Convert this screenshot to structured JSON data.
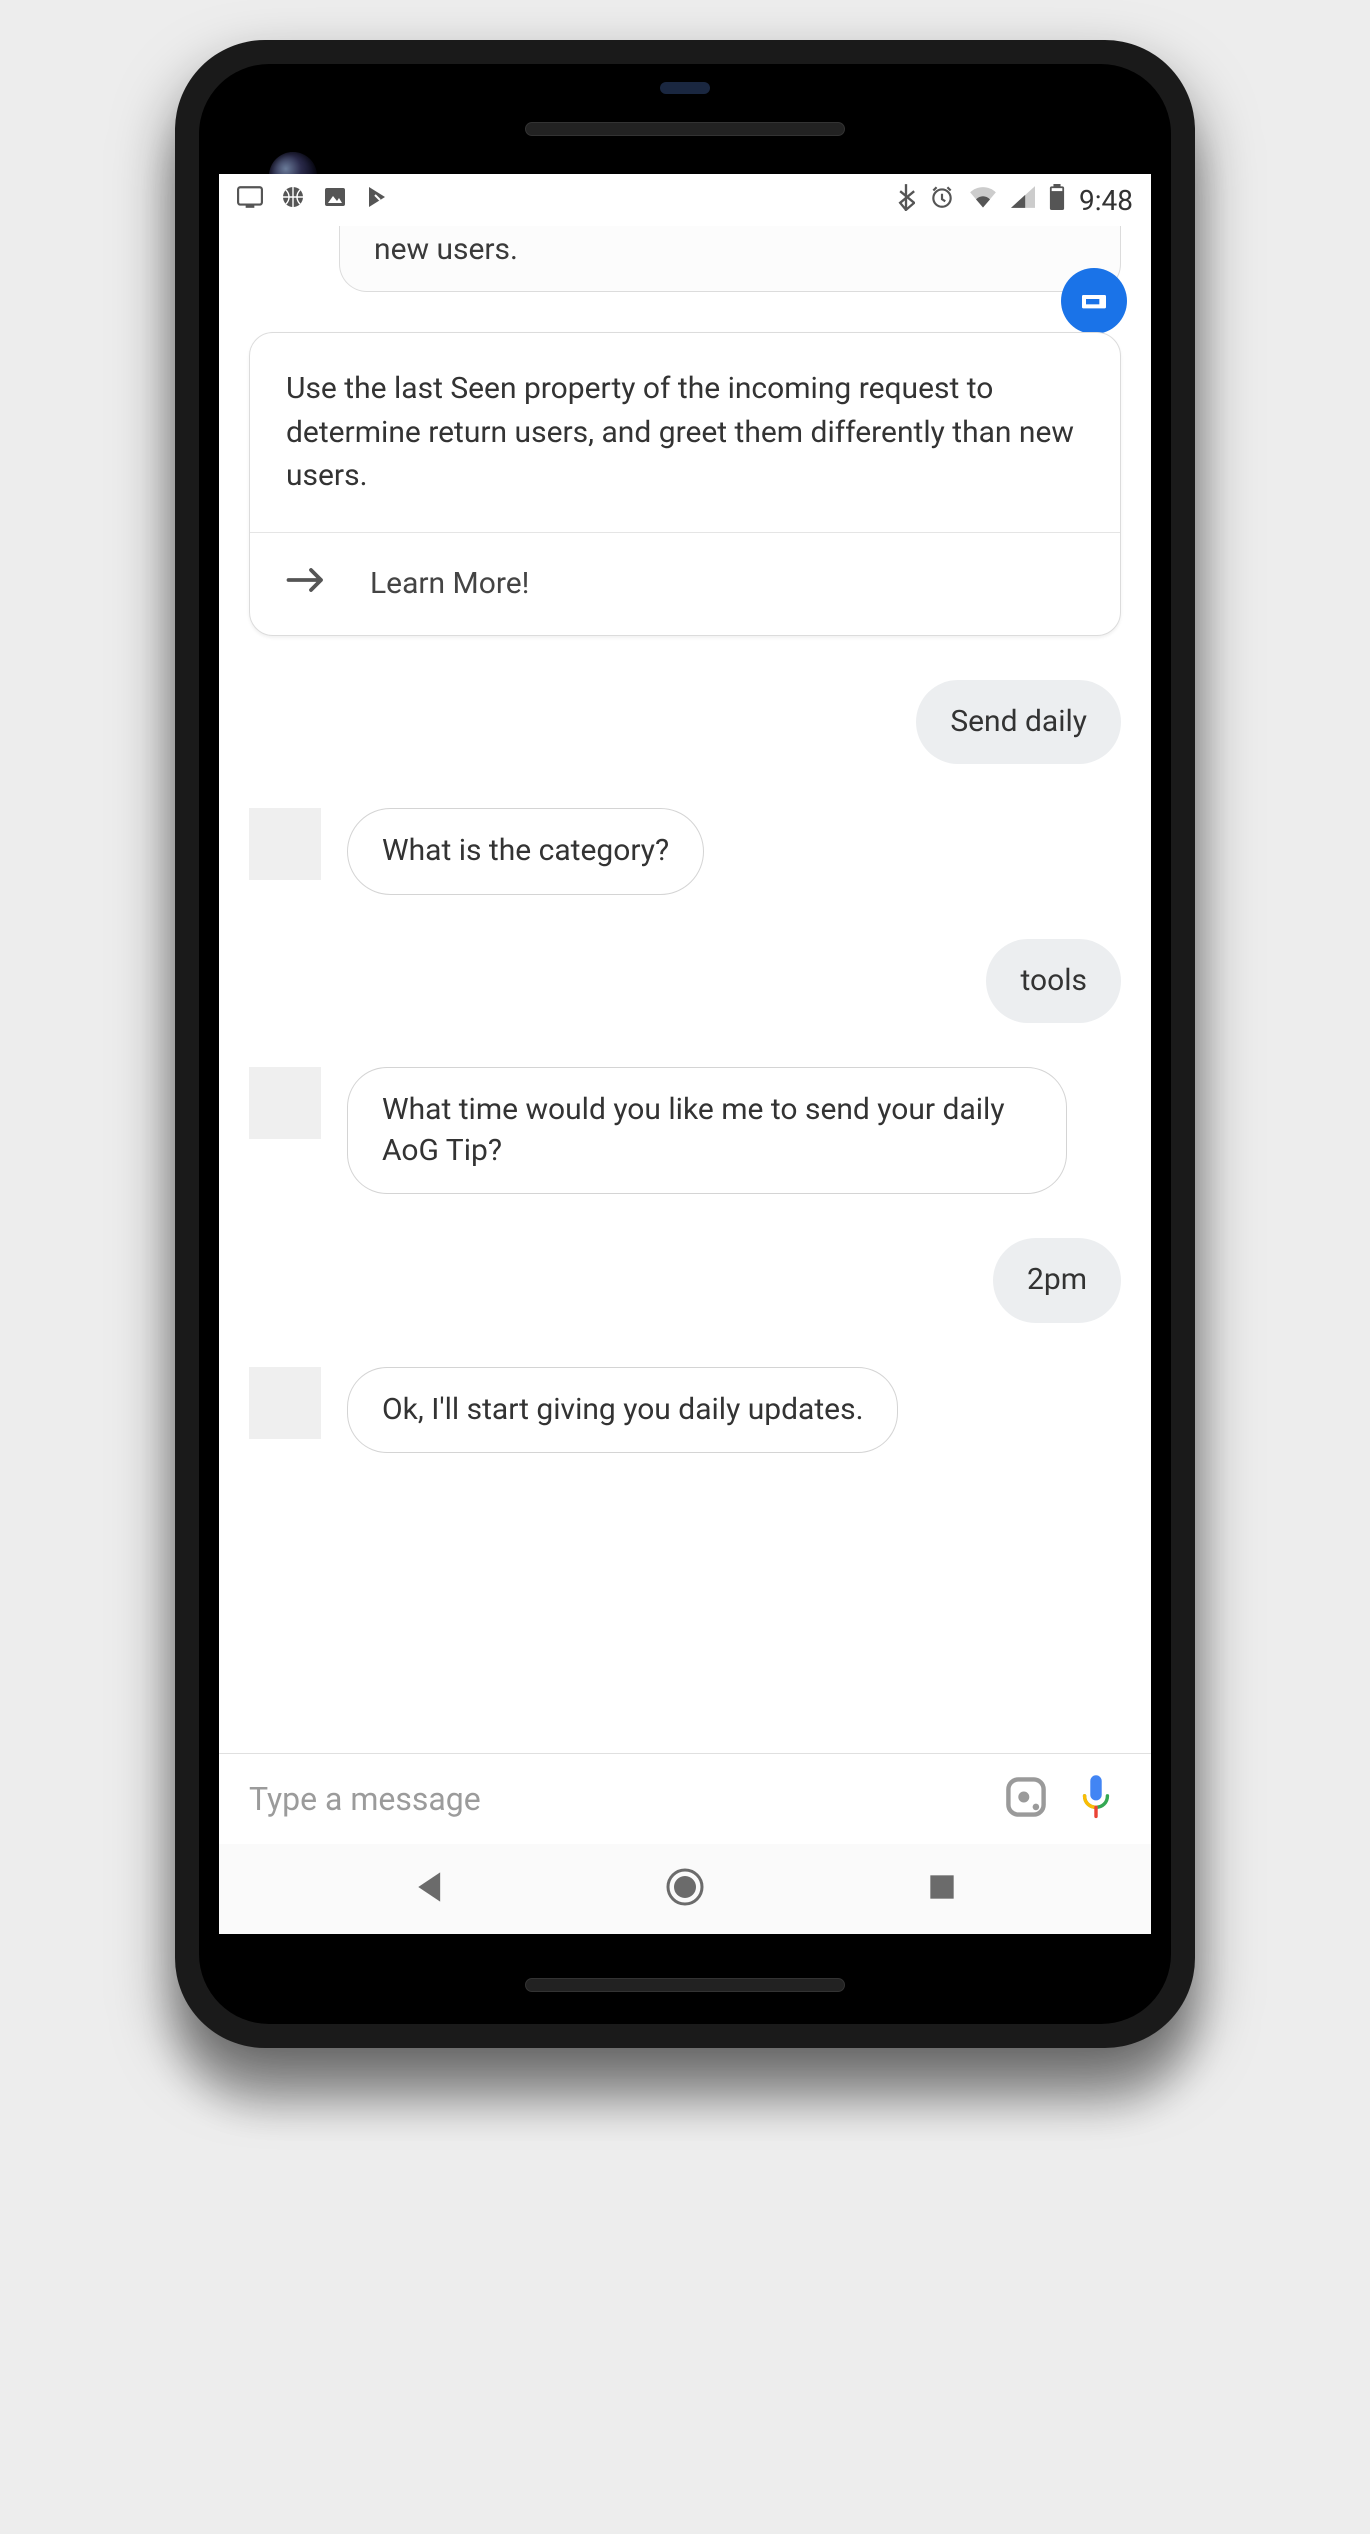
{
  "status_bar": {
    "time": "9:48"
  },
  "partial_card": {
    "text": "new users."
  },
  "tip_card": {
    "body": "Use the last Seen property of the incoming request to determine return users, and greet them differently than new users.",
    "action_label": "Learn More!"
  },
  "messages": {
    "m1_user": "Send daily",
    "m2_assistant": "What is the category?",
    "m3_user": "tools",
    "m4_assistant": "What time would you like me to send your daily AoG Tip?",
    "m5_user": "2pm",
    "m6_assistant": "Ok, I'll start giving you daily updates."
  },
  "input": {
    "placeholder": "Type a message"
  },
  "colors": {
    "accent": "#1a73e8",
    "user_bubble": "#eceef0",
    "border": "#dcdcdc"
  }
}
